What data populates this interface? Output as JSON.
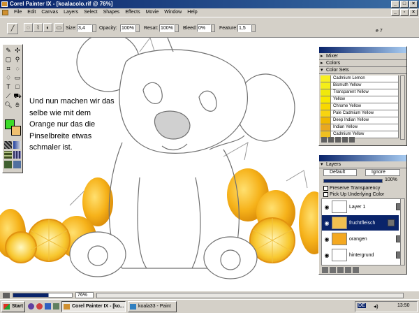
{
  "window": {
    "title": "Corel Painter IX - [koalacolo.rif @ 76%]"
  },
  "menu": [
    "File",
    "Edit",
    "Canvas",
    "Layers",
    "Select",
    "Shapes",
    "Effects",
    "Movie",
    "Window",
    "Help"
  ],
  "property_bar": {
    "size_label": "Size:",
    "size_value": "3,4",
    "opacity_label": "Opacity:",
    "opacity_value": "100%",
    "resat_label": "Resat:",
    "resat_value": "100%",
    "bleed_label": "Bleed:",
    "bleed_value": "0%",
    "feature_label": "Feature:",
    "feature_value": "1,5",
    "page_hint": "e 7"
  },
  "canvas_text": "Und nun machen wir das\nselbe wie mit dem\nOrange nur das die\nPinselbreite etwas\nschmaler ist.",
  "toolbox": {
    "main_color": "#3cdc28",
    "additional_color": "#f0c070"
  },
  "palettes": {
    "mixer": "Mixer",
    "colors": "Colors",
    "color_sets": "Color Sets",
    "color_set_items": [
      {
        "name": "Cadmium Lemon",
        "color": "#f8f020"
      },
      {
        "name": "Bismuth Yellow",
        "color": "#f4ee18"
      },
      {
        "name": "Transparent Yellow",
        "color": "#f0e80c"
      },
      {
        "name": "Yellow",
        "color": "#f8e800"
      },
      {
        "name": "Chrome Yellow",
        "color": "#f8d800"
      },
      {
        "name": "Pale Cadmium Yellow",
        "color": "#f8d410"
      },
      {
        "name": "Deep Indian Yellow",
        "color": "#f0b800"
      },
      {
        "name": "Indian Yellow",
        "color": "#e8a820"
      },
      {
        "name": "Cadmium Yellow",
        "color": "#f0c020"
      }
    ]
  },
  "layers": {
    "title": "Layers",
    "composite_method": "Default",
    "composite_depth": "Ignore",
    "opacity": "100%",
    "preserve_transparency": "Preserve Transparency",
    "pick_up_underlying": "Pick Up Underlying Color",
    "items": [
      {
        "name": "Layer 1",
        "selected": false
      },
      {
        "name": "fruchtfleisch",
        "selected": true
      },
      {
        "name": "orangen",
        "selected": false
      },
      {
        "name": "hintergrund",
        "selected": false
      }
    ]
  },
  "status": {
    "zoom": "76%"
  },
  "taskbar": {
    "start": "Start",
    "tasks": [
      "Corel Painter IX - [ko...",
      "koala33 - Paint"
    ],
    "language": "DE",
    "clock": "13:50"
  }
}
